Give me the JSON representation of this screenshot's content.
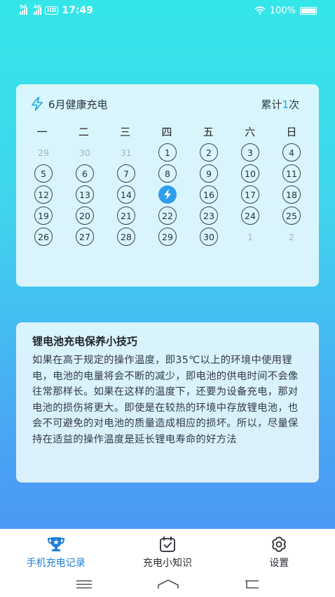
{
  "status_bar": {
    "signal1_label": "5G",
    "signal2_label": "4G",
    "hd_label": "HD",
    "time": "17:49",
    "battery_text": "100%"
  },
  "calendar": {
    "title": "6月健康充电",
    "total_prefix": "累计",
    "total_count": "1",
    "total_suffix": "次",
    "weekdays": [
      "一",
      "二",
      "三",
      "四",
      "五",
      "六",
      "日"
    ],
    "days": [
      "29",
      "30",
      "31",
      "1",
      "2",
      "3",
      "4",
      "5",
      "6",
      "7",
      "8",
      "9",
      "10",
      "11",
      "12",
      "13",
      "14",
      "15",
      "16",
      "17",
      "18",
      "19",
      "20",
      "21",
      "22",
      "23",
      "24",
      "25",
      "26",
      "27",
      "28",
      "29",
      "30",
      "1",
      "2"
    ],
    "muted_days": [
      "29",
      "30",
      "31",
      "1",
      "2"
    ],
    "charged_day": "15",
    "accent_color": "#1ea6e8",
    "charged_color": "#2f9df0"
  },
  "tips": {
    "title": "锂电池充电保养小技巧",
    "body": "如果在高于规定的操作温度，即35℃以上的环境中使用锂电，电池的电量将会不断的减少，即电池的供电时间不会像往常那样长。如果在这样的温度下，还要为设备充电，那对电池的损伤将更大。即使是在较热的环境中存放锂电池，也会不可避免的对电池的质量造成相应的损坏。所以，尽量保持在适益的操作温度是延长锂电寿命的好方法"
  },
  "bottom_nav": {
    "items": [
      {
        "label": "手机充电记录",
        "icon": "trophy-icon",
        "active": true
      },
      {
        "label": "充电小知识",
        "icon": "calendar-check-icon",
        "active": false
      },
      {
        "label": "设置",
        "icon": "gear-icon",
        "active": false
      }
    ],
    "active_color": "#1e7fd9"
  },
  "system_nav": {
    "icons": [
      "menu-icon",
      "home-icon",
      "back-icon"
    ]
  }
}
